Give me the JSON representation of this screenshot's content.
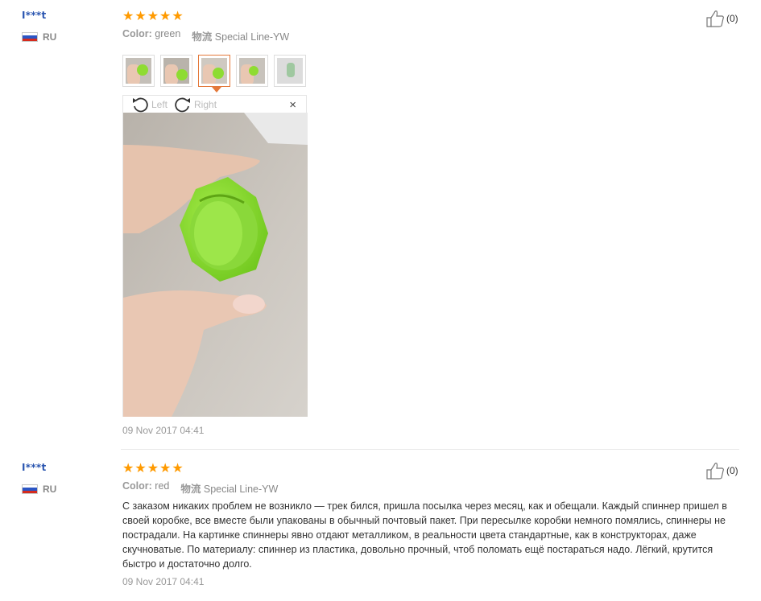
{
  "reviews": [
    {
      "user": "I***t",
      "country": "RU",
      "rating": 5,
      "stars": [
        "★",
        "★",
        "★",
        "★",
        "★"
      ],
      "color_label": "Color:",
      "color_value": "green",
      "shipping_label": "物流",
      "shipping_value": "Special Line-YW",
      "helpful_count": "(0)",
      "rotate_left": "Left",
      "rotate_right": "Right",
      "close": "×",
      "date": "09 Nov 2017 04:41"
    },
    {
      "user": "I***t",
      "country": "RU",
      "rating": 5,
      "stars": [
        "★",
        "★",
        "★",
        "★",
        "★"
      ],
      "color_label": "Color:",
      "color_value": "red",
      "shipping_label": "物流",
      "shipping_value": "Special Line-YW",
      "helpful_count": "(0)",
      "text": "С заказом никаких проблем не возникло — трек бился, пришла посылка через месяц, как и обещали. Каждый спиннер пришел в своей коробке, все вместе были упакованы в обычный почтовый пакет. При пересылке коробки немного помялись, спиннеры не пострадали. На картинке спиннеры явно отдают металликом, в реальности цвета стандартные, как в конструкторах, даже скучноватые. По материалу: спиннер из пластика, довольно прочный, чтоб поломать ещё постараться надо. Лёгкий, крутится быстро и достаточно долго.",
      "date": "09 Nov 2017 04:41"
    }
  ],
  "colors": {
    "star": "#ff9a00",
    "username": "#2a55b0",
    "active_thumb": "#e4793b",
    "spinner": "#8edc32"
  },
  "icons": [
    "thumbs-up-icon",
    "russia-flag-icon",
    "rotate-left-icon",
    "rotate-right-icon",
    "close-icon"
  ]
}
